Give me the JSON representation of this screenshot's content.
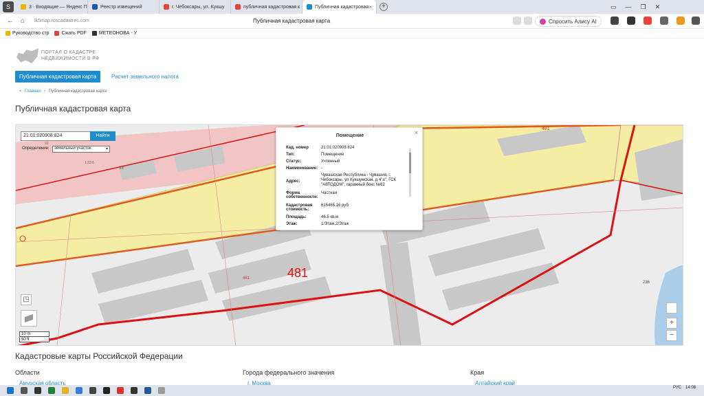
{
  "browser": {
    "tabs": [
      {
        "label": "3 · Входящие — Яндекс П",
        "color": "#f0b400"
      },
      {
        "label": "Реестр извещений",
        "color": "#2255aa"
      },
      {
        "label": "г. Чебоксары, ул. Кукшу",
        "color": "#e5443a"
      },
      {
        "label": "публичная кадастровая к",
        "color": "#e5443a"
      },
      {
        "label": "Публичная кадастровая",
        "color": "#1e8ccd"
      }
    ],
    "new_tab": "+",
    "url": "lk5map.roscadastres.com",
    "page_title": "Публичная кадастровая карта",
    "alice_label": "Спросить Алису AI",
    "bookmarks": [
      "Руководство стр",
      "Сжать PDF",
      "МЕТЕОНОВА - У"
    ]
  },
  "site": {
    "logo_line1": "ПОРТАЛ О КАДАСТРЕ",
    "logo_line2": "НЕДВИЖИМОСТИ В РФ",
    "nav_primary": "Публичная кадастровая карта",
    "nav_secondary": "Расчет земельного налога",
    "breadcrumb_home": "Главная",
    "breadcrumb_sep": "›",
    "breadcrumb_current": "Публичная кадастровая карта",
    "page_heading": "Публичная кадастровая карта",
    "accent": "#1e8ccd"
  },
  "map": {
    "search_value": "21:01:020908:824",
    "find_button": "Найти",
    "definition_label": "Определение:",
    "definition_value": "земельный участок",
    "labels": {
      "big": "481",
      "top_right": "481",
      "a": "33",
      "b": "481",
      "c": "236",
      "d": "1:33:6",
      "e": "92"
    },
    "zoom_in": "+",
    "zoom_out": "−",
    "scale_m": "10 m",
    "scale_ft": "50 ft",
    "popup": {
      "title": "Помещение",
      "close": "×",
      "rows": [
        {
          "k": "Кад. номер",
          "v": "21:01:020908:824"
        },
        {
          "k": "Тип:",
          "v": "Помещение"
        },
        {
          "k": "Статус:",
          "v": "Учтенный"
        },
        {
          "k": "Наименование:",
          "v": "-"
        },
        {
          "k": "Адрес:",
          "v": "Чувашская Республика - Чувашия, г. Чебоксары, ул Кукшумская, д 4\"а\", ГСК \"АВТОДОМ\", гаражный бокс №62"
        },
        {
          "k": "Форма собственности:",
          "v": "Частная"
        },
        {
          "k": "Кадастровая стоимость:",
          "v": "615465.16 руб"
        },
        {
          "k": "Площадь:",
          "v": "46.5 кв.м"
        },
        {
          "k": "Этаж:",
          "v": "1/Этаж,2/Этаж"
        }
      ]
    }
  },
  "bottom": {
    "section_title": "Кадастровые карты Российской Федерации",
    "columns": [
      {
        "heading": "Области",
        "first": "Амурская область"
      },
      {
        "heading": "Города федерального значения",
        "first": "г. Москва"
      },
      {
        "heading": "Края",
        "first": "Алтайский край"
      }
    ]
  },
  "system": {
    "lang": "РУС",
    "time": "14:08"
  }
}
